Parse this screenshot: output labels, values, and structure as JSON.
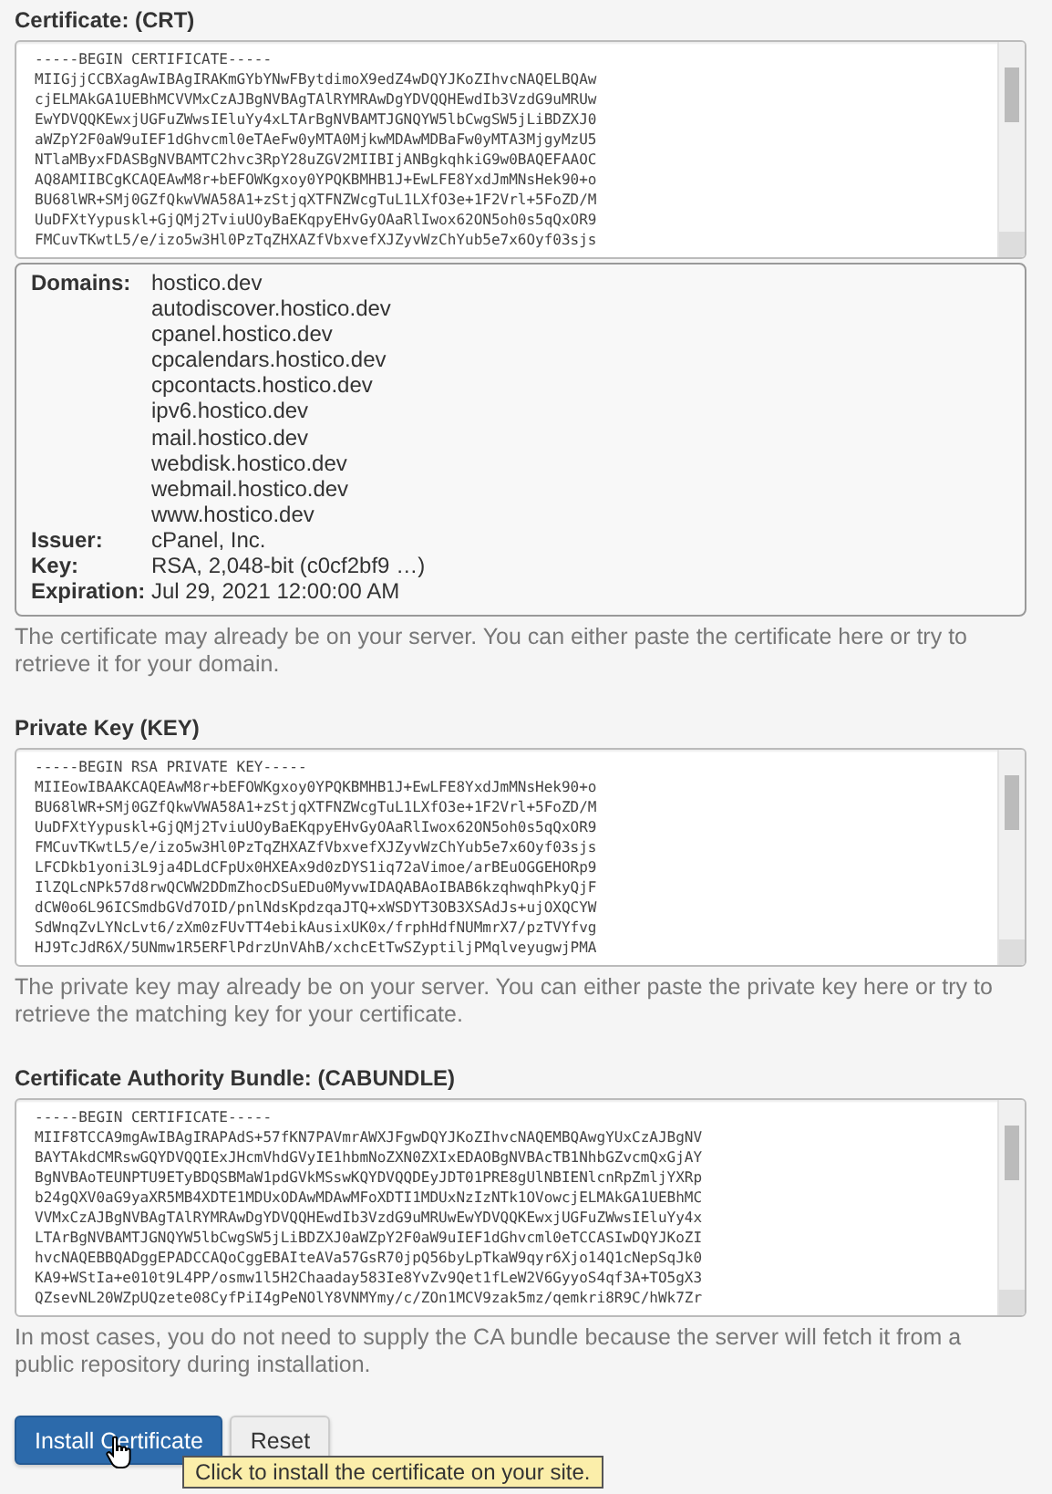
{
  "certificate": {
    "label": "Certificate: (CRT)",
    "lines": [
      "-----BEGIN CERTIFICATE-----",
      "MIIGjjCCBXagAwIBAgIRAKmGYbYNwFBytdimoX9edZ4wDQYJKoZIhvcNAQELBQAw",
      "cjELMAkGA1UEBhMCVVMxCzAJBgNVBAgTAlRYMRAwDgYDVQQHEwdIb3VzdG9uMRUw",
      "EwYDVQQKEwxjUGFuZWwsIEluYy4xLTArBgNVBAMTJGNQYW5lbCwgSW5jLiBDZXJ0",
      "aWZpY2F0aW9uIEF1dGhvcml0eTAeFw0yMTA0MjkwMDAwMDBaFw0yMTA3MjgyMzU5",
      "NTlaMByxFDASBgNVBAMTC2hvc3RpY28uZGV2MIIBIjANBgkqhkiG9w0BAQEFAAOC",
      "AQ8AMIIBCgKCAQEAwM8r+bEFOWKgxoy0YPQKBMHB1J+EwLFE8YxdJmMNsHek90+o",
      "BU68lWR+SMj0GZfQkwVWA58A1+zStjqXTFNZWcgTuL1LXfO3e+1F2Vrl+5FoZD/M",
      "UuDFXtYypuskl+GjQMj2TviuUOyBaEKqpyEHvGyOAaRlIwox62ON5oh0s5qQxOR9",
      "FMCuvTKwtL5/e/izo5w3Hl0PzTqZHXAZfVbxvefXJZyvWzChYub5e7x6Oyf03sjs"
    ],
    "details": [
      {
        "label": "Domains:",
        "values": [
          "hostico.dev",
          "autodiscover.hostico.dev",
          "cpanel.hostico.dev",
          "cpcalendars.hostico.dev",
          "cpcontacts.hostico.dev",
          "ipv6.hostico.dev",
          "mail.hostico.dev",
          "webdisk.hostico.dev",
          "webmail.hostico.dev",
          "www.hostico.dev"
        ]
      },
      {
        "label": "Issuer:",
        "values": [
          "cPanel, Inc."
        ]
      },
      {
        "label": "Key:",
        "values": [
          "RSA, 2,048-bit (c0cf2bf9 …)"
        ]
      },
      {
        "label": "Expiration:",
        "values": [
          "Jul 29, 2021 12:00:00 AM"
        ]
      }
    ],
    "help": "The certificate may already be on your server. You can either paste the certificate here or try to retrieve it for your domain."
  },
  "private_key": {
    "label": "Private Key (KEY)",
    "lines": [
      "-----BEGIN RSA PRIVATE KEY-----",
      "MIIEowIBAAKCAQEAwM8r+bEFOWKgxoy0YPQKBMHB1J+EwLFE8YxdJmMNsHek90+o",
      "BU68lWR+SMj0GZfQkwVWA58A1+zStjqXTFNZWcgTuL1LXfO3e+1F2Vrl+5FoZD/M",
      "UuDFXtYypuskl+GjQMj2TviuUOyBaEKqpyEHvGyOAaRlIwox62ON5oh0s5qQxOR9",
      "FMCuvTKwtL5/e/izo5w3Hl0PzTqZHXAZfVbxvefXJZyvWzChYub5e7x6Oyf03sjs",
      "LFCDkb1yoni3L9ja4DLdCFpUx0HXEAx9d0zDYS1iq72aVimoe/arBEuOGGEHORp9",
      "IlZQLcNPk57d8rwQCWW2DDmZhocDSuEDu0MyvwIDAQABAoIBAB6kzqhwqhPkyQjF",
      "dCW0o6L96ICSmdbGVd7OID/pnlNdsKpdzqaJTQ+xWSDYT3OB3XSAdJs+ujOXQCYW",
      "SdWnqZvLYNcLvt6/zXm0zFUvTT4ebikAusixUK0x/frphHdfNUMmrX7/pzTVYfvg",
      "HJ9TcJdR6X/5UNmw1R5ERFlPdrzUnVAhB/xchcEtTwSZyptiljPMqlveyugwjPMA"
    ],
    "help": "The private key may already be on your server. You can either paste the private key here or try to retrieve the matching key for your certificate."
  },
  "ca_bundle": {
    "label": "Certificate Authority Bundle: (CABUNDLE)",
    "lines": [
      "-----BEGIN CERTIFICATE-----",
      "MIIF8TCCA9mgAwIBAgIRAPAdS+57fKN7PAVmrAWXJFgwDQYJKoZIhvcNAQEMBQAwgYUxCzAJBgNV",
      "BAYTAkdCMRswGQYDVQQIExJHcmVhdGVyIE1hbmNoZXN0ZXIxEDAOBgNVBAcTB1NhbGZvcmQxGjAY",
      "BgNVBAoTEUNPTU9ETyBDQSBMaW1pdGVkMSswKQYDVQQDEyJDT01PRE8gUlNBIENlcnRpZmljYXRp",
      "b24gQXV0aG9yaXR5MB4XDTE1MDUxODAwMDAwMFoXDTI1MDUxNzIzNTk1OVowcjELMAkGA1UEBhMC",
      "VVMxCzAJBgNVBAgTAlRYMRAwDgYDVQQHEwdIb3VzdG9uMRUwEwYDVQQKEwxjUGFuZWwsIEluYy4x",
      "LTArBgNVBAMTJGNQYW5lbCwgSW5jLiBDZXJ0aWZpY2F0aW9uIEF1dGhvcml0eTCCASIwDQYJKoZI",
      "hvcNAQEBBQADggEPADCCAQoCggEBAIteAVa57GsR70jpQ56byLpTkaW9qyr6Xjo14Q1cNepSqJk0",
      "KA9+WStIa+e010t9L4PP/osmw1l5H2Chaaday583Ie8YvZv9Qet1fLeW2V6GyyoS4qf3A+TO5gX3",
      "QZsevNL20WZpUQzete08CyfPiI4gPeNOlY8VNMYmy/c/ZOn1MCV9zak5mz/qemkri8R9C/hWk7Zr"
    ],
    "help": "In most cases, you do not need to supply the CA bundle because the server will fetch it from a public repository during installation."
  },
  "buttons": [
    {
      "label": "Install Certificate",
      "kind": "primary"
    },
    {
      "label": "Reset",
      "kind": "default"
    }
  ],
  "tooltip": "Click to install the certificate on your site."
}
